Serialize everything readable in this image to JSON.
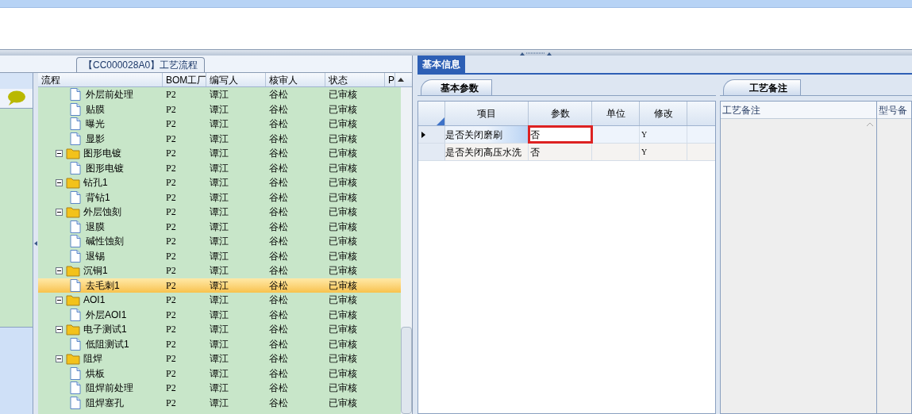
{
  "flow_panel": {
    "tab": "【CC000028A0】工艺流程",
    "columns": [
      "流程",
      "BOM工厂",
      "编写人",
      "核审人",
      "状态",
      "P"
    ],
    "tree": [
      {
        "kind": "file",
        "label": "外层前处理",
        "bom": "P2",
        "writer": "谭江",
        "reviewer": "谷松",
        "status": "已审核",
        "selected": false
      },
      {
        "kind": "file",
        "label": "贴膜",
        "bom": "P2",
        "writer": "谭江",
        "reviewer": "谷松",
        "status": "已审核",
        "selected": false
      },
      {
        "kind": "file",
        "label": "曝光",
        "bom": "P2",
        "writer": "谭江",
        "reviewer": "谷松",
        "status": "已审核",
        "selected": false
      },
      {
        "kind": "file",
        "label": "显影",
        "bom": "P2",
        "writer": "谭江",
        "reviewer": "谷松",
        "status": "已审核",
        "selected": false
      },
      {
        "kind": "folder",
        "label": "图形电镀",
        "bom": "P2",
        "writer": "谭江",
        "reviewer": "谷松",
        "status": "已审核",
        "selected": false,
        "expanded": true,
        "children": [
          {
            "kind": "file",
            "label": "图形电镀",
            "bom": "P2",
            "writer": "谭江",
            "reviewer": "谷松",
            "status": "已审核",
            "selected": false
          }
        ]
      },
      {
        "kind": "folder",
        "label": "钻孔1",
        "bom": "P2",
        "writer": "谭江",
        "reviewer": "谷松",
        "status": "已审核",
        "selected": false,
        "expanded": true,
        "children": [
          {
            "kind": "file",
            "label": "背钻1",
            "bom": "P2",
            "writer": "谭江",
            "reviewer": "谷松",
            "status": "已审核",
            "selected": false
          }
        ]
      },
      {
        "kind": "folder",
        "label": "外层蚀刻",
        "bom": "P2",
        "writer": "谭江",
        "reviewer": "谷松",
        "status": "已审核",
        "selected": false,
        "expanded": true,
        "children": [
          {
            "kind": "file",
            "label": "退膜",
            "bom": "P2",
            "writer": "谭江",
            "reviewer": "谷松",
            "status": "已审核",
            "selected": false
          },
          {
            "kind": "file",
            "label": "碱性蚀刻",
            "bom": "P2",
            "writer": "谭江",
            "reviewer": "谷松",
            "status": "已审核",
            "selected": false
          },
          {
            "kind": "file",
            "label": "退锡",
            "bom": "P2",
            "writer": "谭江",
            "reviewer": "谷松",
            "status": "已审核",
            "selected": false
          }
        ]
      },
      {
        "kind": "folder",
        "label": "沉铜1",
        "bom": "P2",
        "writer": "谭江",
        "reviewer": "谷松",
        "status": "已审核",
        "selected": false,
        "expanded": true,
        "children": [
          {
            "kind": "file",
            "label": "去毛刺1",
            "bom": "P2",
            "writer": "谭江",
            "reviewer": "谷松",
            "status": "已审核",
            "selected": true
          }
        ]
      },
      {
        "kind": "folder",
        "label": "AOI1",
        "bom": "P2",
        "writer": "谭江",
        "reviewer": "谷松",
        "status": "已审核",
        "selected": false,
        "expanded": true,
        "children": [
          {
            "kind": "file",
            "label": "外层AOI1",
            "bom": "P2",
            "writer": "谭江",
            "reviewer": "谷松",
            "status": "已审核",
            "selected": false
          }
        ]
      },
      {
        "kind": "folder",
        "label": "电子测试1",
        "bom": "P2",
        "writer": "谭江",
        "reviewer": "谷松",
        "status": "已审核",
        "selected": false,
        "expanded": true,
        "children": [
          {
            "kind": "file",
            "label": "低阻测试1",
            "bom": "P2",
            "writer": "谭江",
            "reviewer": "谷松",
            "status": "已审核",
            "selected": false
          }
        ]
      },
      {
        "kind": "folder",
        "label": "阻焊",
        "bom": "P2",
        "writer": "谭江",
        "reviewer": "谷松",
        "status": "已审核",
        "selected": false,
        "expanded": true,
        "children": [
          {
            "kind": "file",
            "label": "烘板",
            "bom": "P2",
            "writer": "谭江",
            "reviewer": "谷松",
            "status": "已审核",
            "selected": false
          },
          {
            "kind": "file",
            "label": "阻焊前处理",
            "bom": "P2",
            "writer": "谭江",
            "reviewer": "谷松",
            "status": "已审核",
            "selected": false
          },
          {
            "kind": "file",
            "label": "阻焊塞孔",
            "bom": "P2",
            "writer": "谭江",
            "reviewer": "谷松",
            "status": "已审核",
            "selected": false
          }
        ]
      }
    ]
  },
  "info_panel": {
    "tab": "基本信息",
    "params_tab": "基本参数",
    "param_columns": [
      "项目",
      "参数",
      "单位",
      "修改"
    ],
    "params": [
      {
        "item": "是否关闭磨刷",
        "value": "否",
        "modify": "Y",
        "selected": true
      },
      {
        "item": "是否关闭高压水洗",
        "value": "否",
        "modify": "Y",
        "selected": false
      }
    ],
    "notes_tab": "工艺备注",
    "notes_columns": [
      "工艺备注",
      "型号备"
    ]
  }
}
